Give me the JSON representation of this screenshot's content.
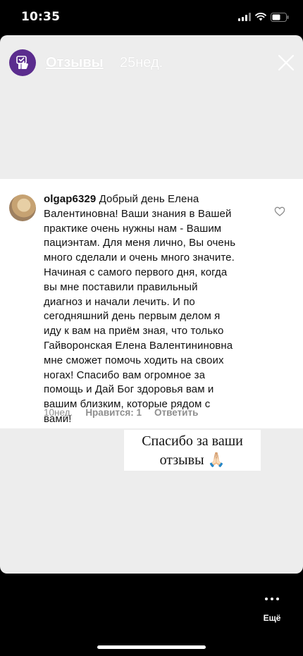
{
  "status_bar": {
    "time": "10:35",
    "icons": [
      "signal-icon",
      "wifi-icon",
      "battery-icon"
    ]
  },
  "story": {
    "title": "Отзывы",
    "age": "25нед.",
    "avatar_icon": "thumbs-up-icon",
    "avatar_color": "#5b2c8e",
    "close_icon": "close-icon"
  },
  "comment": {
    "username": "olgap6329",
    "lines": [
      "Добрый день Елена",
      "Валентиновна! Ваши знания в Вашей",
      "практике очень нужны нам - Вашим",
      "пациэнтам. Для меня лично, Вы очень",
      "много сделали и очень много значите.",
      "Начиная с самого первого дня, когда",
      "вы мне поставили правильный",
      "диагноз и начали лечить. И по",
      "сегодняшний день первым делом я",
      "иду к вам на приём зная, что только",
      "Гайворонская Елена Валентининовна",
      "мне сможет помочь ходить на своих",
      "ногах! Спасибо вам огромное за",
      "помощь и Дай Бог здоровья вам и",
      "вашим близким, которые рядом с",
      "вами!"
    ],
    "time": "10нед.",
    "likes": "Нравится: 1",
    "reply": "Ответить"
  },
  "sticker": {
    "line1": "Спасибо за ваши",
    "line2": "отзывы",
    "emoji": "🙏🏻"
  },
  "more": {
    "label": "Ещё"
  }
}
